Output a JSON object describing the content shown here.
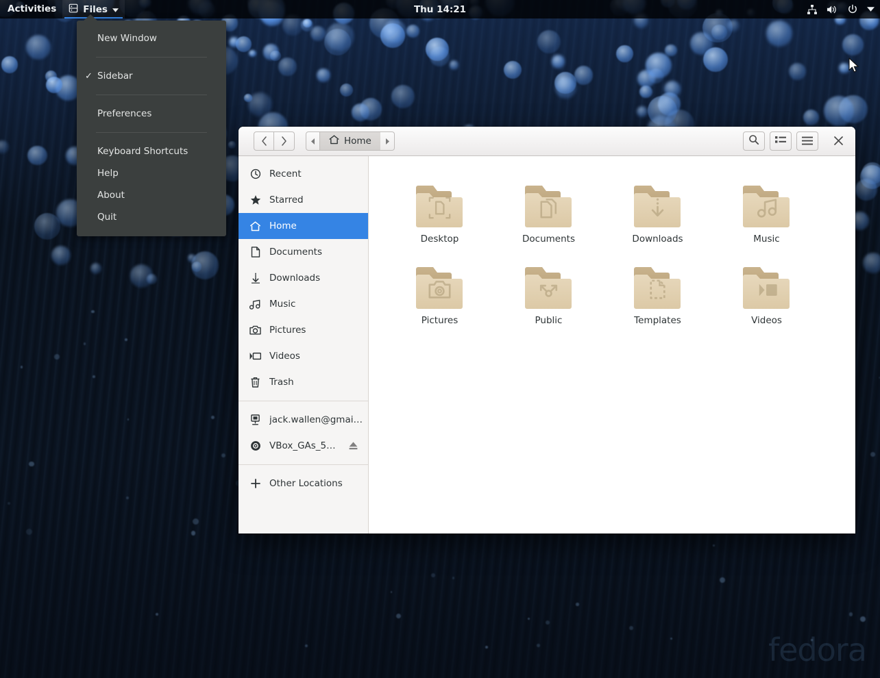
{
  "topbar": {
    "activities": "Activities",
    "app_name": "Files",
    "app_icon": "files-window-icon",
    "dropdown_icon": "chevron-down-icon",
    "clock": "Thu 14:21",
    "tray": [
      {
        "name": "network-icon",
        "label": "Network"
      },
      {
        "name": "volume-icon",
        "label": "Volume"
      },
      {
        "name": "power-icon",
        "label": "Power"
      },
      {
        "name": "system-menu-chevron-icon",
        "label": "System Menu"
      }
    ]
  },
  "app_menu": {
    "items": [
      {
        "id": "new-window",
        "label": "New Window",
        "checked": false
      },
      {
        "id": "sidebar",
        "label": "Sidebar",
        "checked": true,
        "check_glyph": "✓"
      },
      {
        "id": "preferences",
        "label": "Preferences",
        "checked": false
      },
      {
        "id": "keyboard-shortcuts",
        "label": "Keyboard Shortcuts",
        "checked": false
      },
      {
        "id": "help",
        "label": "Help",
        "checked": false
      },
      {
        "id": "about",
        "label": "About",
        "checked": false
      },
      {
        "id": "quit",
        "label": "Quit",
        "checked": false
      }
    ]
  },
  "window": {
    "headerbar": {
      "back_label": "‹",
      "forward_label": "›",
      "path_prev_label": "◂",
      "path_next_label": "▸",
      "breadcrumb": "Home",
      "breadcrumb_icon": "home-icon",
      "search_icon": "search-icon",
      "view_toggle_icon": "list-view-icon",
      "menu_icon": "hamburger-menu-icon",
      "close_icon": "close-icon"
    },
    "sidebar": {
      "groups": [
        {
          "items": [
            {
              "id": "recent",
              "label": "Recent",
              "icon": "clock-icon",
              "active": false
            },
            {
              "id": "starred",
              "label": "Starred",
              "icon": "star-icon",
              "active": false
            },
            {
              "id": "home",
              "label": "Home",
              "icon": "home-icon",
              "active": true
            },
            {
              "id": "documents",
              "label": "Documents",
              "icon": "document-icon",
              "active": false
            },
            {
              "id": "downloads",
              "label": "Downloads",
              "icon": "download-icon",
              "active": false
            },
            {
              "id": "music",
              "label": "Music",
              "icon": "music-icon",
              "active": false
            },
            {
              "id": "pictures",
              "label": "Pictures",
              "icon": "camera-icon",
              "active": false
            },
            {
              "id": "videos",
              "label": "Videos",
              "icon": "video-icon",
              "active": false
            },
            {
              "id": "trash",
              "label": "Trash",
              "icon": "trash-icon",
              "active": false
            }
          ]
        },
        {
          "items": [
            {
              "id": "network-share",
              "label": "jack.wallen@gmai…",
              "icon": "remote-computer-icon",
              "active": false
            },
            {
              "id": "vbox-guest-additions",
              "label": "VBox_GAs_5…",
              "icon": "optical-disc-icon",
              "active": false,
              "eject": true,
              "eject_icon": "eject-icon"
            }
          ]
        },
        {
          "items": [
            {
              "id": "other-locations",
              "label": "Other Locations",
              "icon": "plus-icon",
              "active": false
            }
          ]
        }
      ]
    },
    "files": [
      {
        "name": "Desktop",
        "emblem": "desktop-emblem"
      },
      {
        "name": "Documents",
        "emblem": "documents-emblem"
      },
      {
        "name": "Downloads",
        "emblem": "downloads-emblem"
      },
      {
        "name": "Music",
        "emblem": "music-emblem"
      },
      {
        "name": "Pictures",
        "emblem": "pictures-emblem"
      },
      {
        "name": "Public",
        "emblem": "public-share-emblem"
      },
      {
        "name": "Templates",
        "emblem": "templates-emblem"
      },
      {
        "name": "Videos",
        "emblem": "videos-emblem"
      }
    ]
  },
  "desktop": {
    "watermark": "fedora"
  },
  "colors": {
    "accent": "#3584e4",
    "topbar_bg": "#000000",
    "menu_bg": "#3b3f3e",
    "sidebar_bg": "#f6f5f4",
    "folder_body": "#e0cfb0",
    "folder_tab": "#c3ad87"
  }
}
